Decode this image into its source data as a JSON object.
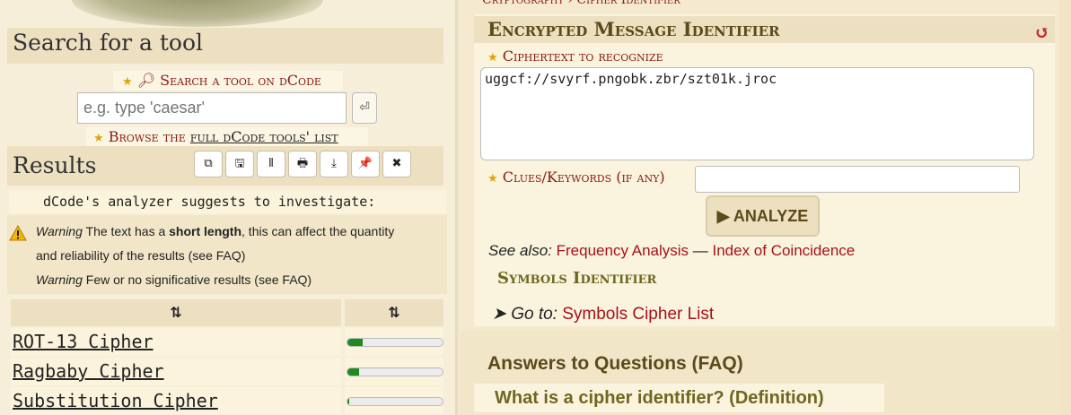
{
  "search": {
    "heading": "Search for a tool",
    "link_label": "Search a tool on dCode",
    "placeholder": "e.g. type 'caesar'",
    "go_icon": "enter-icon",
    "browse_prefix": "Browse the ",
    "browse_link": "full dCode tools' list"
  },
  "results": {
    "heading": "Results",
    "toolbar": [
      {
        "name": "copy-button",
        "icon": "⧉"
      },
      {
        "name": "save-button",
        "icon": "🖫"
      },
      {
        "name": "columns-button",
        "icon": "⦀"
      },
      {
        "name": "print-button",
        "icon": "🖶"
      },
      {
        "name": "download-button",
        "icon": "⤓"
      },
      {
        "name": "pin-button",
        "icon": "📌"
      },
      {
        "name": "close-button",
        "icon": "✖"
      }
    ],
    "suggest": "dCode's analyzer suggests to investigate:",
    "warnings": {
      "w1_label": "Warning",
      "w1_pre": " The text has a ",
      "w1_bold": "short length",
      "w1_post": ", this can affect the quantity",
      "w1_line2": "and reliability of the results (see FAQ)",
      "w2_label": "Warning",
      "w2_text": " Few or no significative results (see FAQ)"
    },
    "sort_label_1": "⇅",
    "sort_label_2": "⇅",
    "rows": [
      {
        "name": "ROT-13 Cipher",
        "score": 0.16
      },
      {
        "name": "Ragbaby Cipher",
        "score": 0.12
      },
      {
        "name": "Substitution Cipher",
        "score": 0.02
      }
    ]
  },
  "tool": {
    "breadcrumb": "Cryptography  ›  Cipher Identifier",
    "title": "Encrypted Message Identifier",
    "reset_icon": "↺",
    "cipher_label": "Ciphertext to recognize",
    "cipher_value": "uggcf://svyrf.pngobk.zbr/szt01k.jroc",
    "clues_label": "Clues/Keywords (if any)",
    "clues_value": "",
    "analyze_label": "▶ ANALYZE",
    "see_also_label": "See also:",
    "see_also_1": "Frequency Analysis",
    "see_also_sep": " — ",
    "see_also_2": "Index of Coincidence",
    "symbols_title": "Symbols Identifier",
    "goto_label": "➤ Go to:",
    "goto_link": "Symbols Cipher List"
  },
  "faq": {
    "heading": "Answers to Questions (FAQ)",
    "question": "What is a cipher identifier? (Definition)"
  },
  "colors": {
    "link_red": "#8a1a0f",
    "heading_olive": "#5b4a1a",
    "bar_green": "#1f8a1f"
  }
}
